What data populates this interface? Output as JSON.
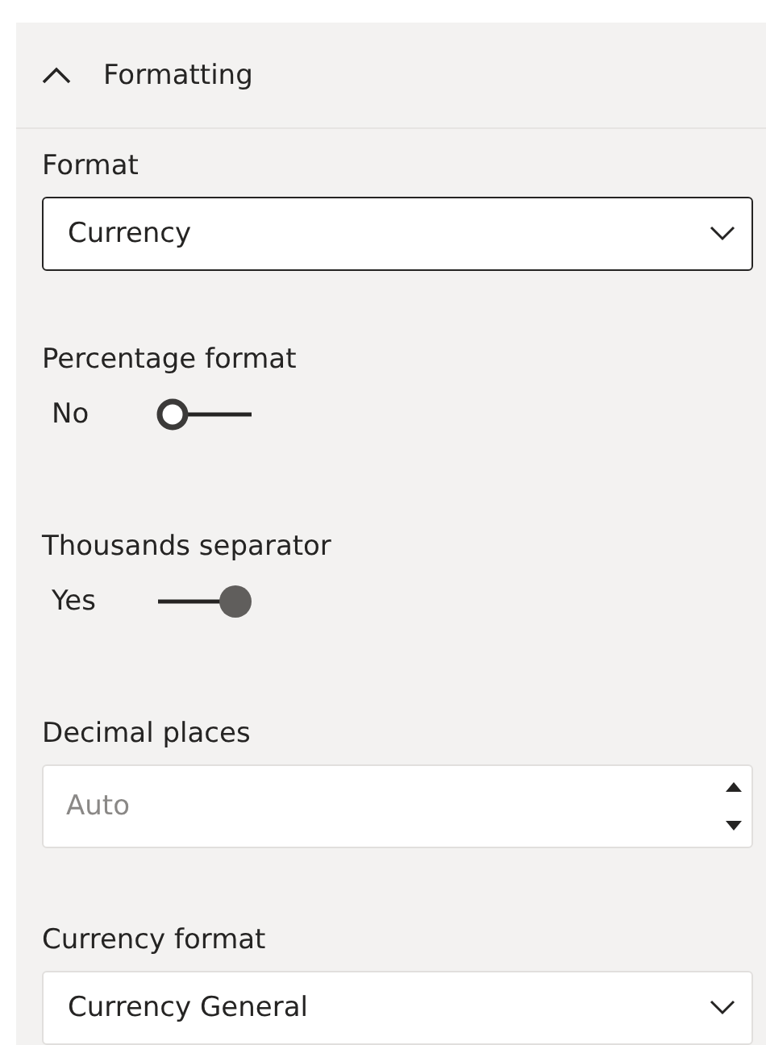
{
  "section": {
    "title": "Formatting",
    "expanded": true
  },
  "fields": [
    {
      "kind": "dropdown",
      "label": "Format",
      "value": "Currency",
      "focused": true
    },
    {
      "kind": "toggle",
      "label": "Percentage format",
      "state_text": "No",
      "on": false
    },
    {
      "kind": "toggle",
      "label": "Thousands separator",
      "state_text": "Yes",
      "on": true
    },
    {
      "kind": "number",
      "label": "Decimal places",
      "placeholder": "Auto"
    },
    {
      "kind": "dropdown",
      "label": "Currency format",
      "value": "Currency General",
      "focused": false
    }
  ]
}
